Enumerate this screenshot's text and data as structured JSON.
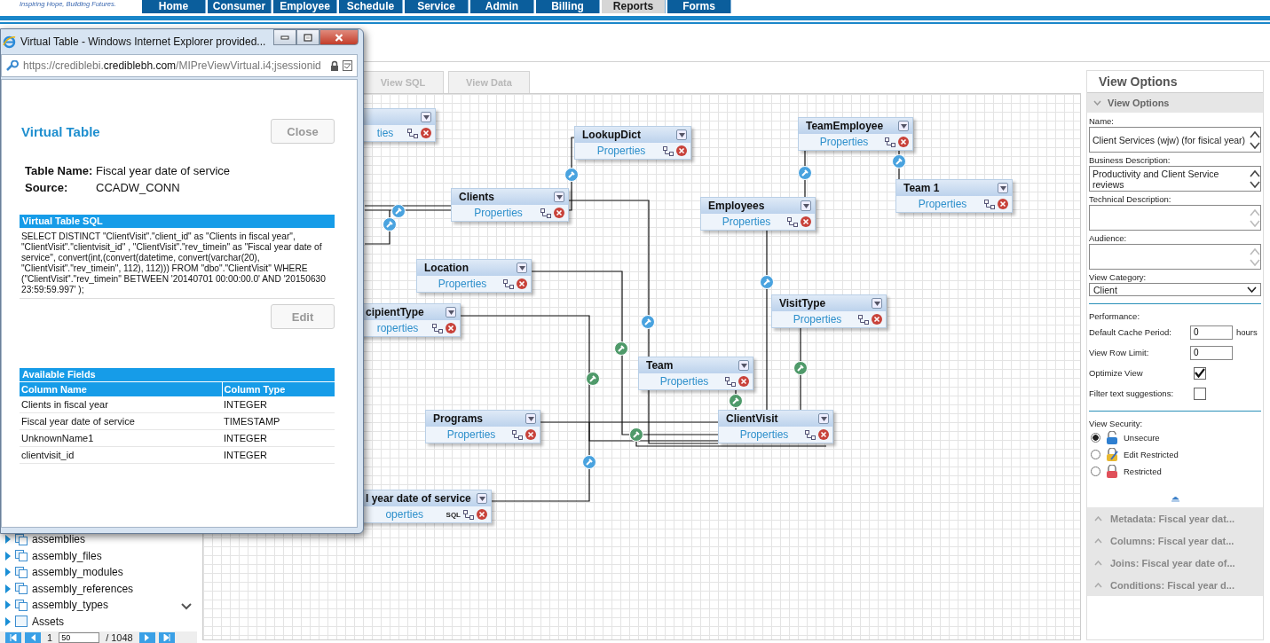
{
  "brand": {
    "tagline": "Inspiring Hope, Building Futures."
  },
  "nav": [
    {
      "label": "Home",
      "selected": false
    },
    {
      "label": "Consumer",
      "selected": false
    },
    {
      "label": "Employee",
      "selected": false
    },
    {
      "label": "Schedule",
      "selected": false
    },
    {
      "label": "Service",
      "selected": false
    },
    {
      "label": "Admin",
      "selected": false
    },
    {
      "label": "Billing",
      "selected": false
    },
    {
      "label": "Reports",
      "selected": true
    },
    {
      "label": "Forms",
      "selected": false
    }
  ],
  "popup": {
    "title": "Virtual Table - Windows Internet Explorer provided...",
    "url_prefix": "https://crediblebi.",
    "url_domain": "crediblebh.com",
    "url_path": "/MIPreViewVirtual.i4;jsessionid",
    "heading": "Virtual Table",
    "close_button": "Close",
    "fields": [
      {
        "label": "Table Name:",
        "value": "Fiscal year date of service"
      },
      {
        "label": "Source:",
        "value": "CCADW_CONN"
      }
    ],
    "sql_title": "Virtual Table SQL",
    "sql": "SELECT DISTINCT \"ClientVisit\".\"client_id\" as \"Clients in fiscal year\", \"ClientVisit\".\"clientvisit_id\" , \"ClientVisit\".\"rev_timein\" as \"Fiscal year date of service\", convert(int,(convert(datetime, convert(varchar(20), \"ClientVisit\".\"rev_timein\", 112), 112))) FROM \"dbo\".\"ClientVisit\" WHERE (\"ClientVisit\".\"rev_timein\" BETWEEN '20140701 00:00:00.0' AND '20150630 23:59:59.997' );",
    "edit_button": "Edit",
    "fields_title": "Available Fields",
    "columns": [
      "Column Name",
      "Column Type"
    ],
    "rows": [
      [
        "Clients in fiscal year",
        "INTEGER"
      ],
      [
        "Fiscal year date of service",
        "TIMESTAMP"
      ],
      [
        "UnknownName1",
        "INTEGER"
      ],
      [
        "clientvisit_id",
        "INTEGER"
      ]
    ]
  },
  "tree": {
    "items": [
      {
        "label": "assemblies",
        "kind": "table"
      },
      {
        "label": "assembly_files",
        "kind": "table"
      },
      {
        "label": "assembly_modules",
        "kind": "table"
      },
      {
        "label": "assembly_references",
        "kind": "table"
      },
      {
        "label": "assembly_types",
        "kind": "table"
      },
      {
        "label": "Assets",
        "kind": "view"
      }
    ],
    "pager": {
      "page": "1",
      "page_size": "50",
      "total": "/ 1048"
    }
  },
  "designer": {
    "tabs": [
      {
        "label": "View SQL",
        "selected": false
      },
      {
        "label": "View Data",
        "selected": false
      }
    ],
    "nodes": [
      {
        "link": "ties"
      },
      {
        "title": "LookupDict",
        "link": "Properties"
      },
      {
        "title": "Clients",
        "link": "Properties"
      },
      {
        "title": "TeamEmployee",
        "link": "Properties"
      },
      {
        "title": "Team 1",
        "link": "Properties"
      },
      {
        "title": "Employees",
        "link": "Properties"
      },
      {
        "title": "Location",
        "link": "Properties"
      },
      {
        "title": "cipientType",
        "link": "roperties"
      },
      {
        "title": "VisitType",
        "link": "Properties"
      },
      {
        "title": "Team",
        "link": "Properties"
      },
      {
        "title": "Programs",
        "link": "Properties"
      },
      {
        "title": "ClientVisit",
        "link": "Properties"
      },
      {
        "title": "l year date of service",
        "link": "operties",
        "badge": "SQL"
      }
    ]
  },
  "view_options": {
    "title": "View Options",
    "section": {
      "title": "View Options",
      "expanded": true
    },
    "name_label": "Name:",
    "name_value": "Client Services (wjw) (for fisical year)",
    "business_label": "Business Description:",
    "business_value": "Productivity and Client Service reviews",
    "technical_label": "Technical Description:",
    "audience_label": "Audience:",
    "category_label": "View Category:",
    "category_value": "Client",
    "performance_label": "Performance:",
    "cache_label": "Default Cache Period:",
    "cache_value": "0",
    "cache_unit": "hours",
    "row_limit_label": "View Row Limit:",
    "row_limit_value": "0",
    "optimize_label": "Optimize View",
    "optimize_checked": true,
    "filter_label": "Filter text suggestions:",
    "filter_checked": false,
    "security_label": "View Security:",
    "security": [
      {
        "label": "Unsecure",
        "kind": "unlocked",
        "selected": true
      },
      {
        "label": "Edit Restricted",
        "kind": "edit",
        "selected": false
      },
      {
        "label": "Restricted",
        "kind": "locked",
        "selected": false
      }
    ],
    "collapsed_sections": [
      {
        "title": "Metadata: Fiscal year dat...",
        "expanded": false
      },
      {
        "title": "Columns: Fiscal year dat...",
        "expanded": false
      },
      {
        "title": "Joins: Fiscal year date of...",
        "expanded": false
      },
      {
        "title": "Conditions: Fiscal year d...",
        "expanded": false
      }
    ]
  }
}
